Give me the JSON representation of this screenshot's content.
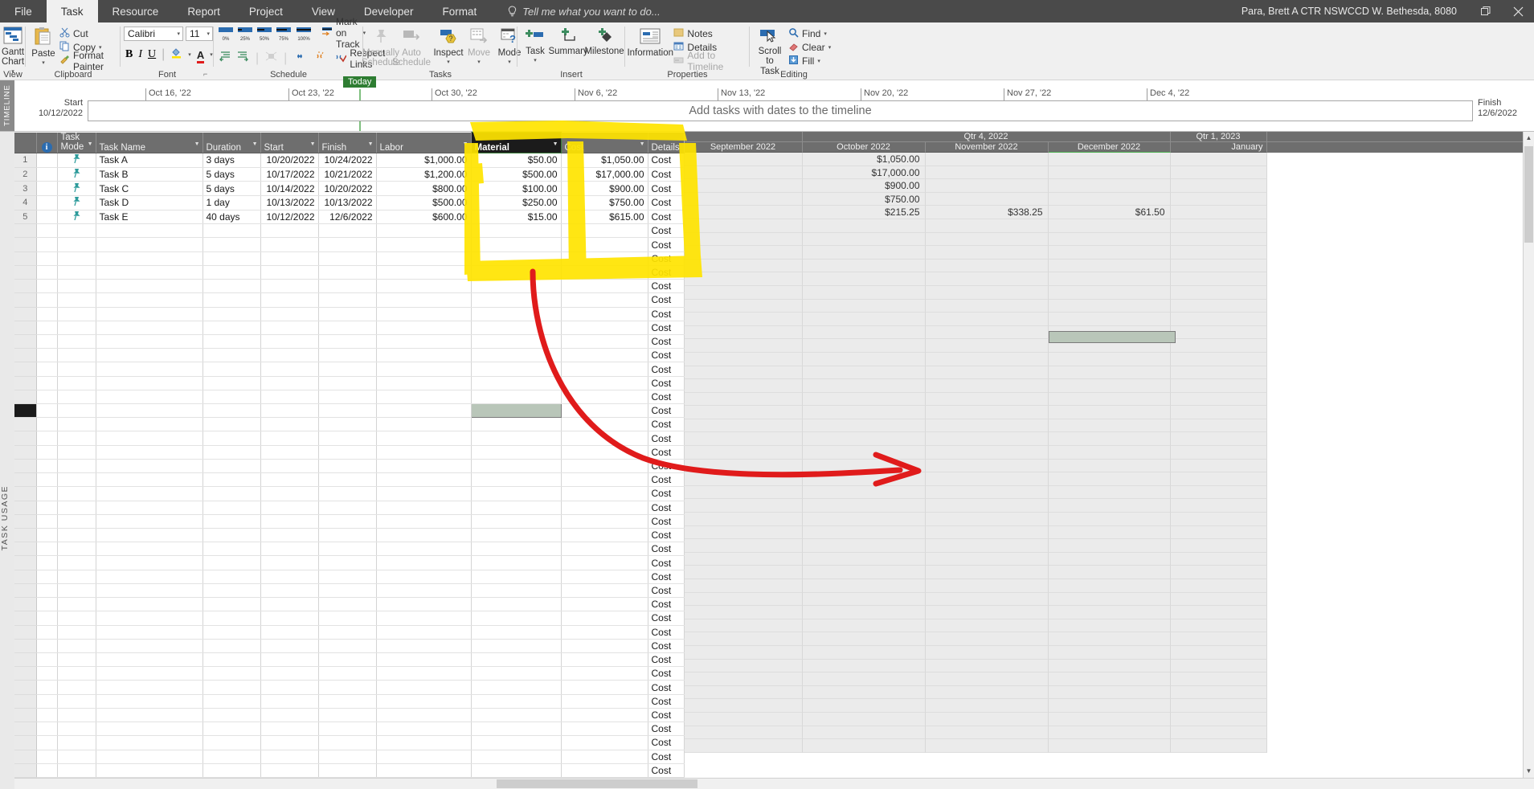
{
  "titlebar": {
    "tabs": [
      "File",
      "Task",
      "Resource",
      "Report",
      "Project",
      "View",
      "Developer",
      "Format"
    ],
    "active_tab": "Task",
    "tell_me": "Tell me what you want to do...",
    "account": "Para, Brett A CTR NSWCCD W. Bethesda, 8080",
    "restore_icon": "restore-window-icon",
    "close_icon": "close-window-icon"
  },
  "ribbon": {
    "groups": [
      "View",
      "Clipboard",
      "Font",
      "Schedule",
      "Tasks",
      "Insert",
      "Properties",
      "Editing"
    ],
    "view": {
      "gantt_line1": "Gantt",
      "gantt_line2": "Chart",
      "icon": "gantt-chart-icon"
    },
    "clipboard": {
      "paste": "Paste",
      "cut": "Cut",
      "copy": "Copy",
      "format_painter": "Format Painter",
      "dialog_launcher": "clipboard-dialog-launcher"
    },
    "font": {
      "font_name": "Calibri",
      "font_size": "11",
      "bold": "B",
      "italic": "I",
      "underline": "U",
      "fill_color": "fill-color-icon",
      "font_color": "font-color-icon",
      "dialog_launcher": "font-dialog-launcher"
    },
    "schedule": {
      "pct": [
        "0%",
        "25%",
        "50%",
        "75%",
        "100%"
      ],
      "mark_on_track": "Mark on Track",
      "respect_links": "Respect Links",
      "indent": "indent-icon",
      "outdent": "outdent-icon",
      "link": "link-tasks-icon",
      "unlink": "unlink-tasks-icon",
      "inactivate": "inactivate-icon"
    },
    "tasks": {
      "manually_l1": "Manually",
      "manually_l2": "Schedule",
      "auto_l1": "Auto",
      "auto_l2": "Schedule",
      "inspect": "Inspect",
      "move": "Move",
      "mode": "Mode"
    },
    "insert": {
      "task": "Task",
      "summary": "Summary",
      "milestone": "Milestone"
    },
    "properties": {
      "information": "Information",
      "notes": "Notes",
      "details": "Details",
      "add_to_timeline": "Add to Timeline"
    },
    "editing": {
      "scroll_l1": "Scroll",
      "scroll_l2": "to Task",
      "find": "Find",
      "clear": "Clear",
      "fill": "Fill"
    }
  },
  "timeline": {
    "strip_label": "TIMELINE",
    "ticks": [
      "Oct 16, '22",
      "Oct 23, '22",
      "Oct 30, '22",
      "Nov 6, '22",
      "Nov 13, '22",
      "Nov 20, '22",
      "Nov 27, '22",
      "Dec 4, '22"
    ],
    "today_label": "Today",
    "placeholder": "Add tasks with dates to the timeline",
    "start_label": "Start",
    "start_date": "10/12/2022",
    "finish_label": "Finish",
    "finish_date": "12/6/2022"
  },
  "view_strip_label": "TASK USAGE",
  "sheet": {
    "columns": [
      {
        "key": "info",
        "label": "",
        "icon": "info-icon"
      },
      {
        "key": "mode",
        "label": "Task\nMode",
        "l1": "Task",
        "l2": "Mode"
      },
      {
        "key": "name",
        "label": "Task Name"
      },
      {
        "key": "duration",
        "label": "Duration"
      },
      {
        "key": "start",
        "label": "Start"
      },
      {
        "key": "finish",
        "label": "Finish"
      },
      {
        "key": "labor",
        "label": "Labor"
      },
      {
        "key": "material",
        "label": "Material",
        "selected": true
      },
      {
        "key": "cost",
        "label": "Cost"
      },
      {
        "key": "details",
        "label": "Details"
      }
    ],
    "rows": [
      {
        "n": "1",
        "mode": "manually-scheduled-pin-icon",
        "name": "Task A",
        "duration": "3 days",
        "start": "10/20/2022",
        "finish": "10/24/2022",
        "labor": "$1,000.00",
        "material": "$50.00",
        "cost": "$1,050.00",
        "details": "Cost"
      },
      {
        "n": "2",
        "mode": "manually-scheduled-pin-icon",
        "name": "Task B",
        "duration": "5 days",
        "start": "10/17/2022",
        "finish": "10/21/2022",
        "labor": "$1,200.00",
        "material": "$500.00",
        "cost": "$17,000.00",
        "details": "Cost"
      },
      {
        "n": "3",
        "mode": "manually-scheduled-pin-icon",
        "name": "Task C",
        "duration": "5 days",
        "start": "10/14/2022",
        "finish": "10/20/2022",
        "labor": "$800.00",
        "material": "$100.00",
        "cost": "$900.00",
        "details": "Cost"
      },
      {
        "n": "4",
        "mode": "manually-scheduled-pin-icon",
        "name": "Task D",
        "duration": "1 day",
        "start": "10/13/2022",
        "finish": "10/13/2022",
        "labor": "$500.00",
        "material": "$250.00",
        "cost": "$750.00",
        "details": "Cost"
      },
      {
        "n": "5",
        "mode": "manually-scheduled-pin-icon",
        "name": "Task E",
        "duration": "40 days",
        "start": "10/12/2022",
        "finish": "12/6/2022",
        "labor": "$600.00",
        "material": "$15.00",
        "cost": "$615.00",
        "details": "Cost"
      }
    ],
    "empty_details_label": "Cost",
    "empty_row_count": 40
  },
  "timescale": {
    "quarters": [
      {
        "label": "",
        "span": 1
      },
      {
        "label": "Qtr 4, 2022",
        "span": 3
      },
      {
        "label": "Qtr 1, 2023",
        "span": 1
      }
    ],
    "months": [
      "September 2022",
      "October 2022",
      "November 2022",
      "December 2022",
      "January"
    ],
    "rows": [
      {
        "september": "",
        "october": "$1,050.00",
        "november": "",
        "december": "",
        "january": ""
      },
      {
        "september": "",
        "october": "$17,000.00",
        "november": "",
        "december": "",
        "january": ""
      },
      {
        "september": "",
        "october": "$900.00",
        "november": "",
        "december": "",
        "january": ""
      },
      {
        "september": "",
        "october": "$750.00",
        "november": "",
        "december": "",
        "january": ""
      },
      {
        "september": "",
        "october": "$215.25",
        "november": "$338.25",
        "december": "$61.50",
        "january": ""
      }
    ]
  },
  "annotations": {
    "highlight_color": "#ffe400",
    "arrow_color": "#e01b1b",
    "arrow_name": "red-curved-arrow-annotation",
    "highlight_name": "yellow-highlighter-annotation"
  }
}
